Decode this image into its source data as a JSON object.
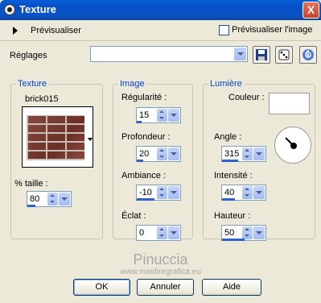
{
  "window": {
    "title": "Texture",
    "close_label": "X"
  },
  "preview": {
    "label": "Prévisualiser",
    "checkbox_label": "Prévisualiser l'image",
    "checked": false
  },
  "settings": {
    "label": "Réglages",
    "value": ""
  },
  "toolbar": {
    "save_icon": "save-icon",
    "random_icon": "dice-icon",
    "reset_icon": "reset-icon"
  },
  "texture": {
    "group_title": "Texture",
    "name": "brick015",
    "size_label": "% taille :",
    "size_value": "80"
  },
  "image": {
    "group_title": "Image",
    "regularity_label": "Régularité :",
    "regularity_value": "15",
    "depth_label": "Profondeur :",
    "depth_value": "20",
    "ambience_label": "Ambiance :",
    "ambience_value": "-10",
    "shine_label": "Éclat :",
    "shine_value": "0"
  },
  "light": {
    "group_title": "Lumière",
    "color_label": "Couleur :",
    "color": "#ffffff",
    "angle_label": "Angle :",
    "angle_value": "315",
    "intensity_label": "Intensité :",
    "intensity_value": "40",
    "height_label": "Hauteur :",
    "height_value": "50"
  },
  "watermark": {
    "line1": "Pinuccia",
    "line2": "www.maidiregrafica.eu"
  },
  "buttons": {
    "ok": "OK",
    "cancel": "Annuler",
    "help": "Aide"
  }
}
